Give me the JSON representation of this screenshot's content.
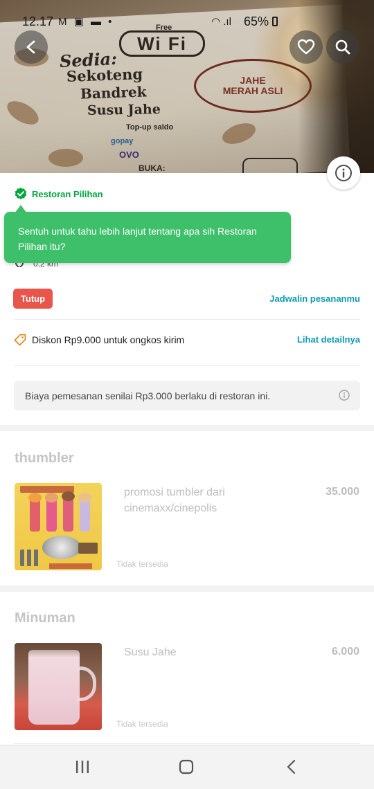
{
  "status_bar": {
    "time": "12.17",
    "left_icons": "M ▣ ▬ •",
    "signal": "◠ .ıl",
    "battery": "65%"
  },
  "hero": {
    "wifi_free": "Free",
    "wifi_text": "Wi Fi",
    "line1": "Sedia:",
    "line2": "Sekoteng",
    "line3": "Bandrek",
    "line4": "Susu Jahe",
    "line5": "Top-up saldo",
    "line6": "gopay",
    "line7": "OVO",
    "line8": "BUKA:",
    "stamp_main": "JAHE MERAH ASLI"
  },
  "badge": {
    "label": "Restoran Pilihan",
    "check_color": "#00a63f"
  },
  "tooltip": {
    "text": "Sentuh untuk tahu lebih lanjut tentang apa sih Restoran Pilihan itu?",
    "color": "#3ec06a"
  },
  "distance": "0,2 km",
  "status_row": {
    "closed_label": "Tutup",
    "schedule_link": "Jadwalin pesananmu"
  },
  "discount": {
    "text": "Diskon Rp9.000 untuk ongkos kirim",
    "link": "Lihat detailnya"
  },
  "fee_notice": "Biaya pemesanan senilai Rp3.000 berlaku di restoran ini.",
  "sections": [
    {
      "title": "thumbler",
      "items": [
        {
          "name": "promosi tumbler dari cinemaxx/cinepolis",
          "price": "35.000",
          "status": "Tidak tersedia"
        }
      ]
    },
    {
      "title": "Minuman",
      "items": [
        {
          "name": "Susu Jahe",
          "price": "6.000",
          "status": "Tidak tersedia"
        }
      ]
    }
  ],
  "colors": {
    "accent_green": "#00a63f",
    "link_blue": "#0c9bb6",
    "closed_red": "#e8564b"
  },
  "icons": {
    "back": "arrow-left-icon",
    "favorite": "heart-icon",
    "search": "search-icon",
    "info": "info-icon",
    "discount": "tag-icon",
    "recent_apps": "recent-apps-icon",
    "home": "home-icon",
    "nav_back": "nav-back-icon"
  }
}
